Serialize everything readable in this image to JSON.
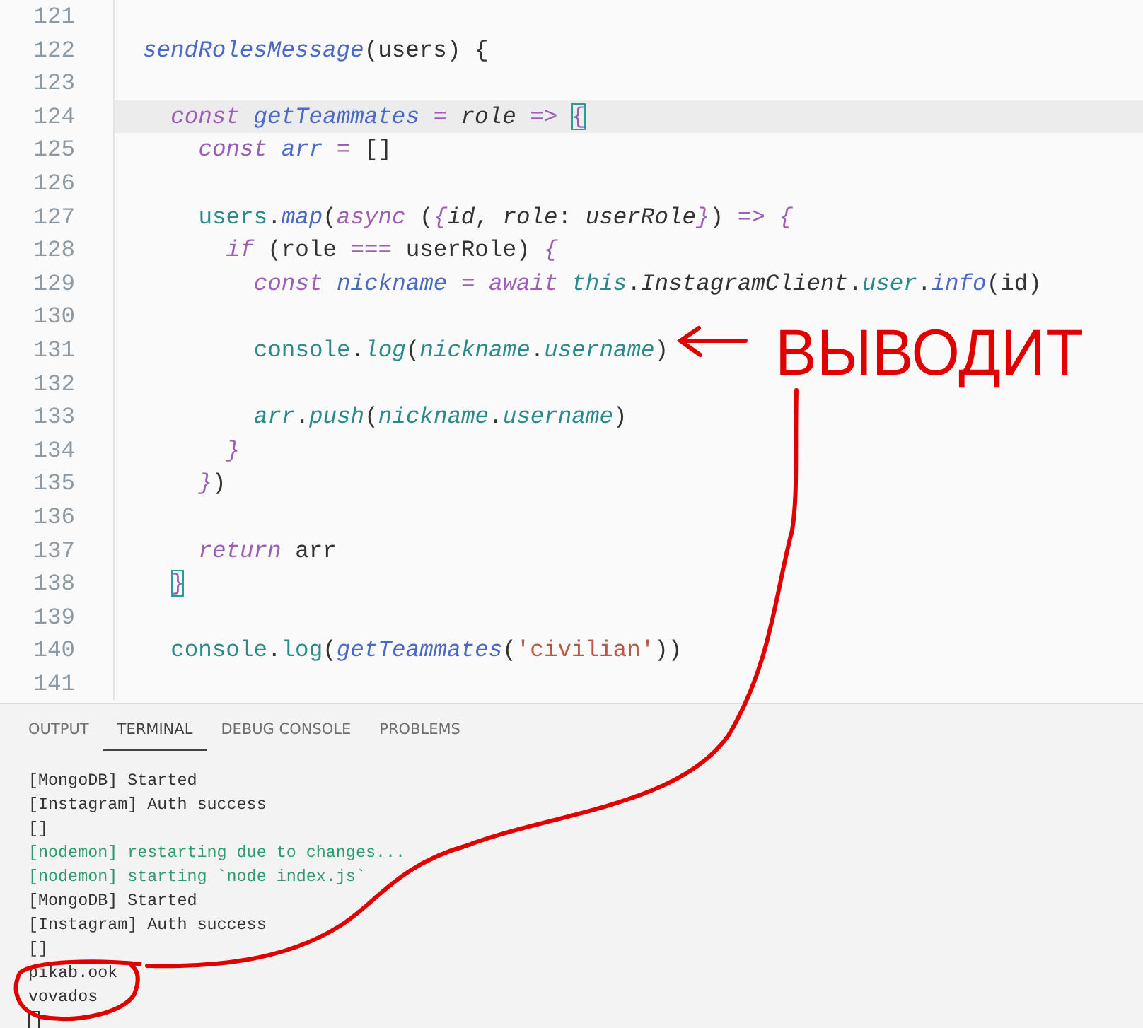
{
  "editor": {
    "lines": [
      {
        "number": "121",
        "highlighted": false
      },
      {
        "number": "122",
        "highlighted": false,
        "tokens": [
          {
            "kind": "fn",
            "text": "sendRolesMessage"
          },
          {
            "kind": "plain",
            "text": "(users) {"
          }
        ],
        "children": [
          {
            "number": "123",
            "highlighted": false
          },
          {
            "number": "124",
            "highlighted": true,
            "tokens": [
              {
                "kind": "kw",
                "text": "const "
              },
              {
                "kind": "fn",
                "text": "getTeammates"
              },
              {
                "kind": "op",
                "text": " = "
              },
              {
                "kind": "param",
                "text": "role"
              },
              {
                "kind": "op",
                "text": " => "
              },
              {
                "kind": "match",
                "text": "{"
              }
            ],
            "children": [
              {
                "number": "125",
                "highlighted": false,
                "tokens": [
                  {
                    "kind": "kw",
                    "text": "const "
                  },
                  {
                    "kind": "fn",
                    "text": "arr"
                  },
                  {
                    "kind": "op",
                    "text": " = "
                  },
                  {
                    "kind": "plain",
                    "text": "[]"
                  }
                ]
              },
              {
                "number": "126",
                "highlighted": false
              },
              {
                "number": "127",
                "highlighted": false,
                "tokens": [
                  {
                    "kind": "id",
                    "text": "users"
                  },
                  {
                    "kind": "plain",
                    "text": "."
                  },
                  {
                    "kind": "fn",
                    "text": "map"
                  },
                  {
                    "kind": "plain",
                    "text": "("
                  },
                  {
                    "kind": "kw",
                    "text": "async"
                  },
                  {
                    "kind": "plain",
                    "text": " ("
                  },
                  {
                    "kind": "kw",
                    "text": "{"
                  },
                  {
                    "kind": "param",
                    "text": "id"
                  },
                  {
                    "kind": "plain",
                    "text": ", "
                  },
                  {
                    "kind": "param",
                    "text": "role"
                  },
                  {
                    "kind": "plain",
                    "text": ": "
                  },
                  {
                    "kind": "param",
                    "text": "userRole"
                  },
                  {
                    "kind": "kw",
                    "text": "}"
                  },
                  {
                    "kind": "plain",
                    "text": ") "
                  },
                  {
                    "kind": "op",
                    "text": "=> "
                  },
                  {
                    "kind": "kw",
                    "text": "{"
                  }
                ],
                "children": [
                  {
                    "number": "128",
                    "highlighted": false,
                    "tokens": [
                      {
                        "kind": "kw",
                        "text": "if"
                      },
                      {
                        "kind": "plain",
                        "text": " (role "
                      },
                      {
                        "kind": "op",
                        "text": "==="
                      },
                      {
                        "kind": "plain",
                        "text": " userRole) "
                      },
                      {
                        "kind": "kw",
                        "text": "{"
                      }
                    ],
                    "children": [
                      {
                        "number": "129",
                        "highlighted": false,
                        "tokens": [
                          {
                            "kind": "kw",
                            "text": "const "
                          },
                          {
                            "kind": "fn",
                            "text": "nickname"
                          },
                          {
                            "kind": "op",
                            "text": " = "
                          },
                          {
                            "kind": "kw",
                            "text": "await "
                          },
                          {
                            "kind": "var",
                            "text": "this"
                          },
                          {
                            "kind": "plain",
                            "text": "."
                          },
                          {
                            "kind": "param",
                            "text": "InstagramClient"
                          },
                          {
                            "kind": "plain",
                            "text": "."
                          },
                          {
                            "kind": "var",
                            "text": "user"
                          },
                          {
                            "kind": "plain",
                            "text": "."
                          },
                          {
                            "kind": "fn",
                            "text": "info"
                          },
                          {
                            "kind": "plain",
                            "text": "(id)"
                          }
                        ]
                      },
                      {
                        "number": "130",
                        "highlighted": false
                      },
                      {
                        "number": "131",
                        "highlighted": false,
                        "tokens": [
                          {
                            "kind": "id",
                            "text": "console"
                          },
                          {
                            "kind": "plain",
                            "text": "."
                          },
                          {
                            "kind": "var",
                            "text": "log"
                          },
                          {
                            "kind": "plain",
                            "text": "("
                          },
                          {
                            "kind": "var",
                            "text": "nickname"
                          },
                          {
                            "kind": "plain",
                            "text": "."
                          },
                          {
                            "kind": "var",
                            "text": "username"
                          },
                          {
                            "kind": "plain",
                            "text": ")"
                          }
                        ]
                      },
                      {
                        "number": "132",
                        "highlighted": false
                      },
                      {
                        "number": "133",
                        "highlighted": false,
                        "tokens": [
                          {
                            "kind": "var",
                            "text": "arr"
                          },
                          {
                            "kind": "plain",
                            "text": "."
                          },
                          {
                            "kind": "var",
                            "text": "push"
                          },
                          {
                            "kind": "plain",
                            "text": "("
                          },
                          {
                            "kind": "var",
                            "text": "nickname"
                          },
                          {
                            "kind": "plain",
                            "text": "."
                          },
                          {
                            "kind": "var",
                            "text": "username"
                          },
                          {
                            "kind": "plain",
                            "text": ")"
                          }
                        ]
                      }
                    ]
                  },
                  {
                    "number": "134",
                    "highlighted": false,
                    "tokens": [
                      {
                        "kind": "kw",
                        "text": "}"
                      }
                    ]
                  }
                ]
              },
              {
                "number": "135",
                "highlighted": false,
                "tokens": [
                  {
                    "kind": "kw",
                    "text": "}"
                  },
                  {
                    "kind": "plain",
                    "text": ")"
                  }
                ]
              },
              {
                "number": "136",
                "highlighted": false
              },
              {
                "number": "137",
                "highlighted": false,
                "tokens": [
                  {
                    "kind": "kw",
                    "text": "return"
                  },
                  {
                    "kind": "plain",
                    "text": " arr"
                  }
                ]
              }
            ]
          },
          {
            "number": "138",
            "highlighted": false,
            "tokens": [
              {
                "kind": "match",
                "text": "}"
              }
            ]
          },
          {
            "number": "139",
            "highlighted": false
          },
          {
            "number": "140",
            "highlighted": false,
            "tokens": [
              {
                "kind": "id",
                "text": "console"
              },
              {
                "kind": "plain",
                "text": "."
              },
              {
                "kind": "id",
                "text": "log"
              },
              {
                "kind": "plain",
                "text": "("
              },
              {
                "kind": "fn",
                "text": "getTeammates"
              },
              {
                "kind": "plain",
                "text": "("
              },
              {
                "kind": "str",
                "text": "'civilian'"
              },
              {
                "kind": "plain",
                "text": "))"
              }
            ]
          },
          {
            "number": "141",
            "highlighted": false
          }
        ]
      }
    ]
  },
  "panel": {
    "tabs": [
      {
        "label": "OUTPUT",
        "selected": false
      },
      {
        "label": "TERMINAL",
        "selected": true
      },
      {
        "label": "DEBUG CONSOLE",
        "selected": false
      },
      {
        "label": "PROBLEMS",
        "selected": false
      }
    ],
    "terminal_lines": [
      {
        "kind": "plain",
        "text": "[MongoDB] Started"
      },
      {
        "kind": "plain",
        "text": "[Instagram] Auth success"
      },
      {
        "kind": "plain",
        "text": "[]"
      },
      {
        "kind": "nodemon",
        "text": "[nodemon] restarting due to changes..."
      },
      {
        "kind": "nodemon",
        "text": "[nodemon] starting `node index.js`"
      },
      {
        "kind": "plain",
        "text": "[MongoDB] Started"
      },
      {
        "kind": "plain",
        "text": "[Instagram] Auth success"
      },
      {
        "kind": "plain",
        "text": "[]"
      },
      {
        "kind": "plain",
        "text": "pikab.ook"
      },
      {
        "kind": "plain",
        "text": "vovados"
      }
    ]
  },
  "annotation": {
    "label": "ВЫВОДИТ"
  }
}
